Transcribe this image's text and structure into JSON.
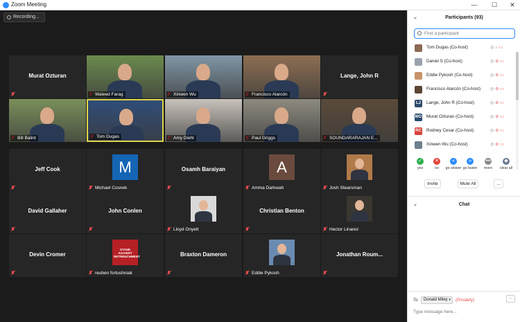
{
  "window": {
    "title": "Zoom Meeting",
    "min": "—",
    "max": "☐",
    "close": "✕"
  },
  "recording": {
    "label": "Recording..."
  },
  "tiles": [
    {
      "name": "Murat Ozturan",
      "mode": "name"
    },
    {
      "name": "Waleed Farag",
      "mode": "video",
      "bg": "#6b8a4e"
    },
    {
      "name": "Xinwen Wu",
      "mode": "video",
      "bg": "#7f96a6"
    },
    {
      "name": "Francisco Alarcón",
      "mode": "video",
      "bg": "#8e6e52"
    },
    {
      "name": "Lange, John R",
      "mode": "name"
    },
    {
      "name": "Bill Balint",
      "mode": "video",
      "bg": "#7a8f5a"
    },
    {
      "name": "Tom Dugas",
      "mode": "video",
      "bg": "#2f4d78",
      "active": true
    },
    {
      "name": "Amy Diehl",
      "mode": "video",
      "bg": "#c8c2bb"
    },
    {
      "name": "Paul Griggs",
      "mode": "video",
      "bg": "#8e8a7f"
    },
    {
      "name": "SOUNDARARAJAN E...",
      "mode": "video",
      "bg": "#5a4a3a"
    },
    {
      "name": "Jeff Cook",
      "mode": "name"
    },
    {
      "name": "Michael Cosnek",
      "mode": "avatar",
      "initial": "M",
      "color": "#1565b5"
    },
    {
      "name": "Osamh Baraiyan",
      "mode": "name"
    },
    {
      "name": "Amma Darkwah",
      "mode": "avatar",
      "initial": "A",
      "color": "#6b4a3e"
    },
    {
      "name": "Josh Stearsman",
      "mode": "photo",
      "bg": "#b07a4a"
    },
    {
      "name": "David Gallaher",
      "mode": "name"
    },
    {
      "name": "John Conlen",
      "mode": "name"
    },
    {
      "name": "Lloyd Onyett",
      "mode": "photo",
      "bg": "#d9d9d9"
    },
    {
      "name": "Christian Benton",
      "mode": "name"
    },
    {
      "name": "Hector Linarez",
      "mode": "photo",
      "bg": "#3a3630"
    },
    {
      "name": "Devin Cromer",
      "mode": "name"
    },
    {
      "name": "reuben fortushniak",
      "mode": "photo",
      "bg": "#b52025",
      "photo_text": "STAND AGAINST RETRENCHMENT"
    },
    {
      "name": "Braxton Dameron",
      "mode": "name"
    },
    {
      "name": "Eddie Pykosh",
      "mode": "photo",
      "bg": "#6a8bb0"
    },
    {
      "name": "Jonathan  Roum...",
      "mode": "name"
    }
  ],
  "participants": {
    "header": "Participants (93)",
    "search_placeholder": "Find a participant",
    "list": [
      {
        "name": "Tom Dugas (Co-host)",
        "av": "",
        "color": "#8c6a55",
        "muted": false
      },
      {
        "name": "Daniel S (Co-host)",
        "av": "",
        "color": "#9aa3ad",
        "muted": true
      },
      {
        "name": "Eddie Pykosh (Co-host)",
        "av": "",
        "color": "#c7936a",
        "muted": true
      },
      {
        "name": "Francisco Alarcón (Co-host)",
        "av": "",
        "color": "#5b4636",
        "muted": true
      },
      {
        "name": "Lange, John R (Co-host)",
        "av": "LJ",
        "color": "#2b4a6b",
        "muted": true
      },
      {
        "name": "Murat Ozturan (Co-host)",
        "av": "MO",
        "color": "#2b4a6b",
        "muted": true
      },
      {
        "name": "Rodney Cesar (Co-host)",
        "av": "RC",
        "color": "#d6423a",
        "muted": true
      },
      {
        "name": "Xinwen Wu (Co-host)",
        "av": "",
        "color": "#6e7f8e",
        "muted": true
      }
    ],
    "reactions": [
      {
        "label": "yes",
        "glyph": "✓",
        "color": "#2eae4d"
      },
      {
        "label": "no",
        "glyph": "✕",
        "color": "#e0443a"
      },
      {
        "label": "go slower",
        "glyph": "«",
        "color": "#2d8cff"
      },
      {
        "label": "go faster",
        "glyph": "»",
        "color": "#2d8cff"
      },
      {
        "label": "more",
        "glyph": "•••",
        "color": "#8a8a8a"
      },
      {
        "label": "clear all",
        "glyph": "◆",
        "color": "#6a7a8f"
      }
    ],
    "buttons": {
      "invite": "Invite",
      "mute_all": "Mute All",
      "more": "..."
    }
  },
  "chat": {
    "header": "Chat",
    "to_label": "To:",
    "to_value": "Donald Miley",
    "privately": "(Privately)",
    "more": "...",
    "input_placeholder": "Type message here..."
  },
  "colors": {
    "accent": "#2d8cff",
    "muted": "#e54a4a",
    "active_border": "#e2d64a"
  }
}
